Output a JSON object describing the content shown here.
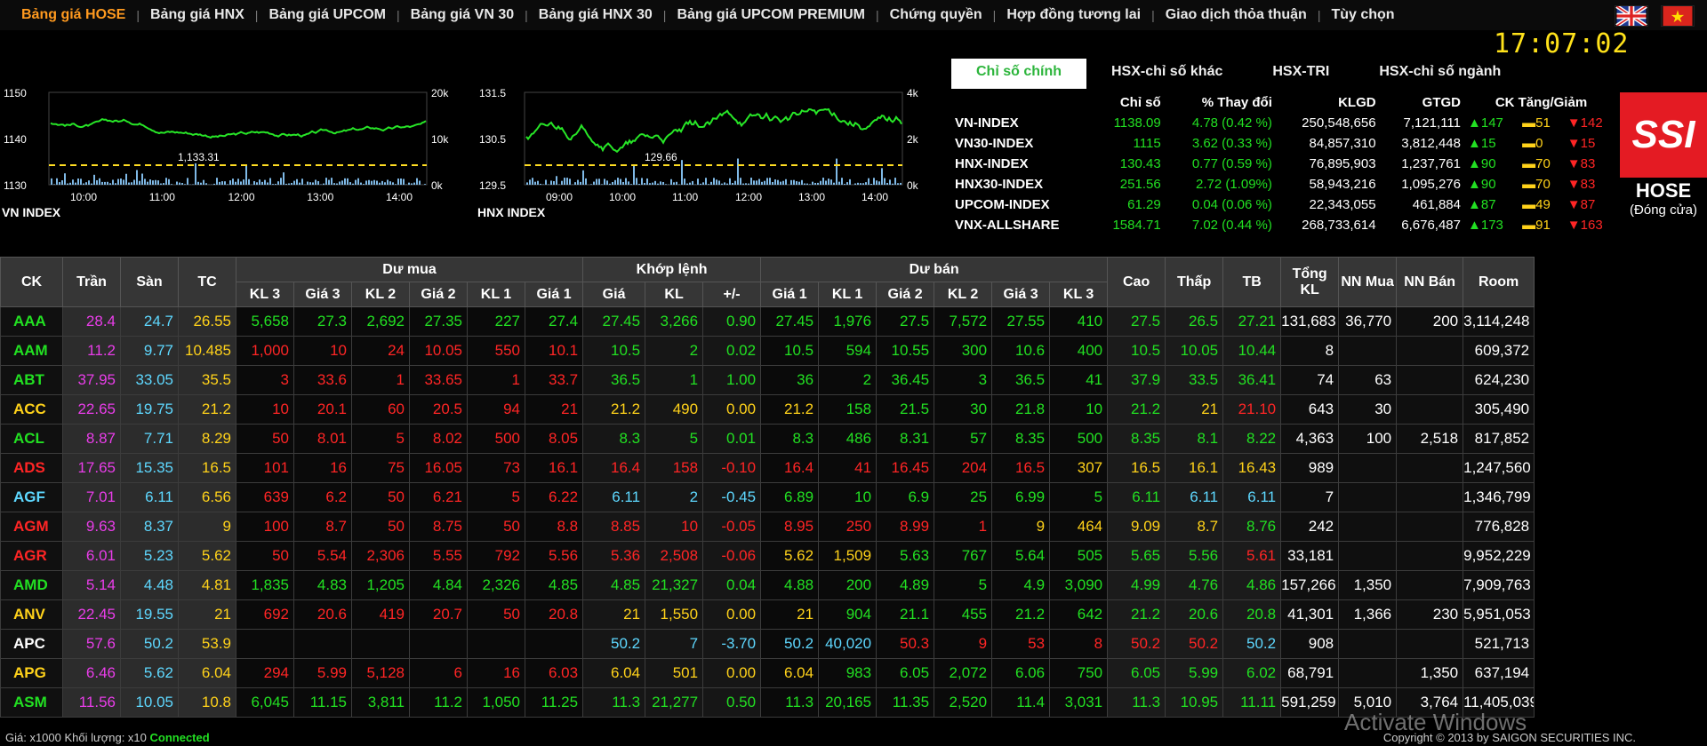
{
  "nav": {
    "items": [
      "Bảng giá HOSE",
      "Bảng giá HNX",
      "Bảng giá UPCOM",
      "Bảng giá VN 30",
      "Bảng giá HNX 30",
      "Bảng giá UPCOM PREMIUM",
      "Chứng quyền",
      "Hợp đồng tương lai",
      "Giao dịch thỏa thuận",
      "Tùy chọn"
    ],
    "active_index": 0
  },
  "flags": [
    "uk-flag-icon",
    "vietnam-flag-icon"
  ],
  "clock": "17:07:02",
  "charts": [
    {
      "name": "VN INDEX",
      "y_left_ticks": [
        "1150",
        "1140",
        "1130"
      ],
      "y_right_ticks": [
        "20k",
        "10k",
        "0k"
      ],
      "x_ticks": [
        "10:00",
        "11:00",
        "12:00",
        "13:00",
        "14:00"
      ],
      "ref_label": "1,133.31"
    },
    {
      "name": "HNX INDEX",
      "y_left_ticks": [
        "131.5",
        "130.5",
        "129.5"
      ],
      "y_right_ticks": [
        "4k",
        "2k",
        "0k"
      ],
      "x_ticks": [
        "09:00",
        "10:00",
        "11:00",
        "12:00",
        "13:00",
        "14:00"
      ],
      "ref_label": "129.66"
    }
  ],
  "index_tabs": [
    "Chỉ số chính",
    "HSX-chỉ số khác",
    "HSX-TRI",
    "HSX-chỉ số ngành"
  ],
  "index_headers": [
    "Chỉ số",
    "% Thay đổi",
    "KLGD",
    "GTGD",
    "CK Tăng/Giảm"
  ],
  "indices": [
    [
      "VN-INDEX",
      "1138.09",
      "4.78 (0.42 %)",
      "250,548,656",
      "7,121,111",
      "147",
      "51",
      "142"
    ],
    [
      "VN30-INDEX",
      "1115",
      "3.62 (0.33 %)",
      "84,857,310",
      "3,812,448",
      "15",
      "0",
      "15"
    ],
    [
      "HNX-INDEX",
      "130.43",
      "0.77 (0.59 %)",
      "76,895,903",
      "1,237,761",
      "90",
      "70",
      "83"
    ],
    [
      "HNX30-INDEX",
      "251.56",
      "2.72 (1.09%)",
      "58,943,216",
      "1,095,276",
      "90",
      "70",
      "83"
    ],
    [
      "UPCOM-INDEX",
      "61.29",
      "0.04 (0.06 %)",
      "22,343,055",
      "461,884",
      "87",
      "49",
      "87"
    ],
    [
      "VNX-ALLSHARE",
      "1584.71",
      "7.02 (0.44 %)",
      "268,733,614",
      "6,676,487",
      "173",
      "91",
      "163"
    ]
  ],
  "brand": {
    "logo": "SSI",
    "exchange": "HOSE",
    "status": "(Đóng cửa)"
  },
  "table": {
    "group_headers": [
      "Dư mua",
      "Khớp lệnh",
      "Dư bán"
    ],
    "single_headers": [
      "CK",
      "Trần",
      "Sàn",
      "TC",
      "Cao",
      "Thấp",
      "TB",
      "Tổng KL",
      "NN Mua",
      "NN Bán",
      "Room"
    ],
    "sub_headers": [
      "KL 3",
      "Giá 3",
      "KL 2",
      "Giá 2",
      "KL 1",
      "Giá 1",
      "Giá",
      "KL",
      "+/-",
      "Giá 1",
      "KL 1",
      "Giá 2",
      "KL 2",
      "Giá 3",
      "KL 3"
    ],
    "rows": [
      {
        "ck": "AAA",
        "c": "cg",
        "v": [
          "28.4",
          "24.7",
          "26.55",
          "5,658",
          "27.3",
          "2,692",
          "27.35",
          "227",
          "27.4",
          "27.45",
          "3,266",
          "0.90",
          "27.45",
          "1,976",
          "27.5",
          "7,572",
          "27.55",
          "410",
          "27.5",
          "26.5",
          "27.21",
          "131,683",
          "36,770",
          "200",
          "3,114,248"
        ],
        "k": "gggggggggggggggggggggggg"
      },
      {
        "ck": "AAM",
        "c": "cg",
        "v": [
          "11.2",
          "9.77",
          "10.485",
          "1,000",
          "10",
          "24",
          "10.05",
          "550",
          "10.1",
          "10.5",
          "2",
          "0.02",
          "10.5",
          "594",
          "10.55",
          "300",
          "10.6",
          "400",
          "10.5",
          "10.05",
          "10.44",
          "8",
          "",
          "",
          "609,372"
        ],
        "k": "rrrrrrggggggggggggrrw"
      },
      {
        "ck": "ABT",
        "c": "cg",
        "v": [
          "37.95",
          "33.05",
          "35.5",
          "3",
          "33.6",
          "1",
          "33.65",
          "1",
          "33.7",
          "36.5",
          "1",
          "1.00",
          "36",
          "2",
          "36.45",
          "3",
          "36.5",
          "41",
          "37.9",
          "33.5",
          "36.41",
          "74",
          "63",
          "",
          "624,230"
        ],
        "k": "rrrrrrgggggggggggggrg"
      },
      {
        "ck": "ACC",
        "c": "cy",
        "v": [
          "22.65",
          "19.75",
          "21.2",
          "10",
          "20.1",
          "60",
          "20.5",
          "94",
          "21",
          "21.2",
          "490",
          "0.00",
          "21.2",
          "158",
          "21.5",
          "30",
          "21.8",
          "10",
          "21.2",
          "21",
          "21.10",
          "643",
          "30",
          "",
          "305,490"
        ],
        "k": "rrrrrryyyyggggggyrr"
      },
      {
        "ck": "ACL",
        "c": "cg",
        "v": [
          "8.87",
          "7.71",
          "8.29",
          "50",
          "8.01",
          "5",
          "8.02",
          "500",
          "8.05",
          "8.3",
          "5",
          "0.01",
          "8.3",
          "486",
          "8.31",
          "57",
          "8.35",
          "500",
          "8.35",
          "8.1",
          "8.22",
          "4,363",
          "100",
          "2,518",
          "817,852"
        ],
        "k": "rrrrrrgggggggggggggrr"
      },
      {
        "ck": "ADS",
        "c": "cr",
        "v": [
          "17.65",
          "15.35",
          "16.5",
          "101",
          "16",
          "75",
          "16.05",
          "73",
          "16.1",
          "16.4",
          "158",
          "-0.10",
          "16.4",
          "41",
          "16.45",
          "204",
          "16.5",
          "307",
          "16.5",
          "16.1",
          "16.43",
          "989",
          "",
          "",
          "1,247,560"
        ],
        "k": "rrrrrrrrrrrrrryyyyrr"
      },
      {
        "ck": "AGF",
        "c": "cc",
        "v": [
          "7.01",
          "6.11",
          "6.56",
          "639",
          "6.2",
          "50",
          "6.21",
          "5",
          "6.22",
          "6.11",
          "2",
          "-0.45",
          "6.89",
          "10",
          "6.9",
          "25",
          "6.99",
          "5",
          "6.11",
          "6.11",
          "6.11",
          "7",
          "",
          "",
          "1,346,799"
        ],
        "k": "rrrrrrcccgggggggccc"
      },
      {
        "ck": "AGM",
        "c": "cr",
        "v": [
          "9.63",
          "8.37",
          "9",
          "100",
          "8.7",
          "50",
          "8.75",
          "50",
          "8.8",
          "8.85",
          "10",
          "-0.05",
          "8.95",
          "250",
          "8.99",
          "1",
          "9",
          "464",
          "9.09",
          "8.7",
          "8.76",
          "242",
          "",
          "",
          "776,828"
        ],
        "k": "rrrrrrrrrrrrryyyygrr"
      },
      {
        "ck": "AGR",
        "c": "cr",
        "v": [
          "6.01",
          "5.23",
          "5.62",
          "50",
          "5.54",
          "2,306",
          "5.55",
          "792",
          "5.56",
          "5.36",
          "2,508",
          "-0.06",
          "5.62",
          "1,509",
          "5.63",
          "767",
          "5.64",
          "505",
          "5.65",
          "5.56",
          "5.61",
          "33,181",
          "",
          "",
          "9,952,229"
        ],
        "k": "rrrrrrrrryyggggggrr"
      },
      {
        "ck": "AMD",
        "c": "cg",
        "v": [
          "5.14",
          "4.48",
          "4.81",
          "1,835",
          "4.83",
          "1,205",
          "4.84",
          "2,326",
          "4.85",
          "4.85",
          "21,327",
          "0.04",
          "4.88",
          "200",
          "4.89",
          "5",
          "4.9",
          "3,090",
          "4.99",
          "4.76",
          "4.86",
          "157,266",
          "1,350",
          "",
          "7,909,763"
        ],
        "k": "gggggggggggggggggggrg"
      },
      {
        "ck": "ANV",
        "c": "cy",
        "v": [
          "22.45",
          "19.55",
          "21",
          "692",
          "20.6",
          "419",
          "20.7",
          "50",
          "20.8",
          "21",
          "1,550",
          "0.00",
          "21",
          "904",
          "21.1",
          "455",
          "21.2",
          "642",
          "21.2",
          "20.6",
          "20.8",
          "41,301",
          "1,366",
          "230",
          "5,951,053"
        ],
        "k": "rrrrrryyyyggggggggrr"
      },
      {
        "ck": "APC",
        "c": "cw",
        "v": [
          "57.6",
          "50.2",
          "53.9",
          "",
          "",
          "",
          "",
          "",
          "",
          "50.2",
          "7",
          "-3.70",
          "50.2",
          "40,020",
          "50.3",
          "9",
          "53",
          "8",
          "50.2",
          "50.2",
          "50.2",
          "908",
          "",
          "",
          "521,713"
        ],
        "k": "rrrrrrcccccrrrrrrccc"
      },
      {
        "ck": "APG",
        "c": "cy",
        "v": [
          "6.46",
          "5.62",
          "6.04",
          "294",
          "5.99",
          "5,128",
          "6",
          "16",
          "6.03",
          "6.04",
          "501",
          "0.00",
          "6.04",
          "983",
          "6.05",
          "2,072",
          "6.06",
          "750",
          "6.05",
          "5.99",
          "6.02",
          "68,791",
          "",
          "1,350",
          "637,194"
        ],
        "k": "rrrrrryyyyggggggggrr"
      },
      {
        "ck": "ASM",
        "c": "cg",
        "v": [
          "11.56",
          "10.05",
          "10.8",
          "6,045",
          "11.15",
          "3,811",
          "11.2",
          "1,050",
          "11.25",
          "11.3",
          "21,277",
          "0.50",
          "11.3",
          "20,165",
          "11.35",
          "2,520",
          "11.4",
          "3,031",
          "11.3",
          "10.95",
          "11.11",
          "591,259",
          "5,010",
          "3,764",
          "11,405,039"
        ],
        "k": "gggggggggggggggggggggg"
      }
    ]
  },
  "footer": {
    "text": "Giá: x1000 Khối lượng: x10",
    "status": "Connected",
    "copyright": "Copyright © 2013 by SAIGON SECURITIES INC."
  },
  "watermark": "Activate Windows"
}
